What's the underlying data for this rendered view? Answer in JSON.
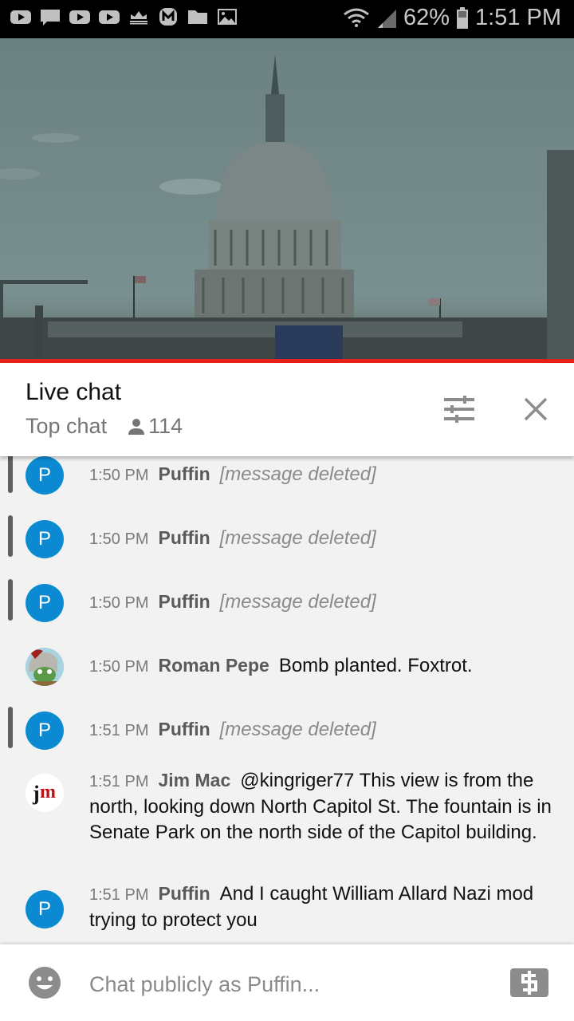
{
  "status_bar": {
    "notification_icons": [
      "youtube-icon",
      "message-icon",
      "youtube-icon",
      "youtube-icon",
      "crown-icon",
      "m-app-icon",
      "folder-icon",
      "image-icon"
    ],
    "battery_percent": "62%",
    "time": "1:51 PM"
  },
  "video": {
    "description": "Live stream of the US Capitol dome",
    "progress_percent": 100,
    "progress_color": "#e62117"
  },
  "chat_header": {
    "title": "Live chat",
    "mode": "Top chat",
    "viewer_count": "114"
  },
  "messages": [
    {
      "time": "1:50 PM",
      "author": "Puffin",
      "text": "[message deleted]",
      "deleted": true,
      "avatar": "P",
      "moderated": true
    },
    {
      "time": "1:50 PM",
      "author": "Puffin",
      "text": "[message deleted]",
      "deleted": true,
      "avatar": "P",
      "moderated": true
    },
    {
      "time": "1:50 PM",
      "author": "Puffin",
      "text": "[message deleted]",
      "deleted": true,
      "avatar": "P",
      "moderated": true
    },
    {
      "time": "1:50 PM",
      "author": "Roman Pepe",
      "text": "Bomb planted. Foxtrot.",
      "deleted": false,
      "avatar": "image",
      "moderated": false
    },
    {
      "time": "1:51 PM",
      "author": "Puffin",
      "text": "[message deleted]",
      "deleted": true,
      "avatar": "P",
      "moderated": true
    },
    {
      "time": "1:51 PM",
      "author": "Jim Mac",
      "text": "@kingriger77 This view is from the north, looking down North Capitol St. The fountain is in Senate Park on the north side of the Capitol building.",
      "deleted": false,
      "avatar": "jm",
      "moderated": false
    },
    {
      "time": "1:51 PM",
      "author": "Puffin",
      "text": "And I caught William Allard Nazi mod trying to protect you",
      "deleted": false,
      "avatar": "P",
      "moderated": false
    }
  ],
  "input": {
    "placeholder": "Chat publicly as Puffin...",
    "value": ""
  },
  "colors": {
    "avatar_blue": "#0b8ad2",
    "accent_red": "#e62117"
  }
}
